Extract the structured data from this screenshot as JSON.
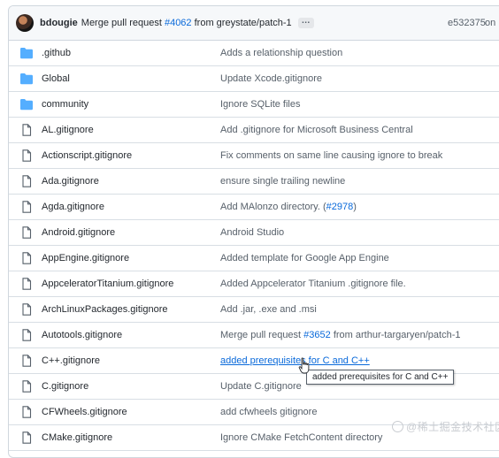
{
  "commit": {
    "author": "bdougie",
    "message_prefix": "Merge pull request",
    "pr_link": "#4062",
    "message_suffix": "from greystate/patch-1",
    "ellipsis": "…",
    "sha": "e532375",
    "on": "on"
  },
  "files": [
    {
      "type": "folder",
      "name": ".github",
      "message": "Adds a relationship question"
    },
    {
      "type": "folder",
      "name": "Global",
      "message": "Update Xcode.gitignore"
    },
    {
      "type": "folder",
      "name": "community",
      "message": "Ignore SQLite files"
    },
    {
      "type": "file",
      "name": "AL.gitignore",
      "message": "Add .gitignore for Microsoft Business Central"
    },
    {
      "type": "file",
      "name": "Actionscript.gitignore",
      "message": "Fix comments on same line causing ignore to break"
    },
    {
      "type": "file",
      "name": "Ada.gitignore",
      "message": "ensure single trailing newline"
    },
    {
      "type": "file",
      "name": "Agda.gitignore",
      "message": "Add MAlonzo directory. (",
      "link": "#2978",
      "after": ")"
    },
    {
      "type": "file",
      "name": "Android.gitignore",
      "message": "Android Studio"
    },
    {
      "type": "file",
      "name": "AppEngine.gitignore",
      "message": "Added template for Google App Engine"
    },
    {
      "type": "file",
      "name": "AppceleratorTitanium.gitignore",
      "message": "Added Appcelerator Titanium .gitignore file."
    },
    {
      "type": "file",
      "name": "ArchLinuxPackages.gitignore",
      "message": "Add .jar, .exe and .msi"
    },
    {
      "type": "file",
      "name": "Autotools.gitignore",
      "message": "Merge pull request ",
      "link": "#3652",
      "after": " from arthur-targaryen/patch-1"
    },
    {
      "type": "file",
      "name": "C++.gitignore",
      "message": "added prerequisites for C and C++",
      "hover": true
    },
    {
      "type": "file",
      "name": "C.gitignore",
      "message": "Update C.gitignore"
    },
    {
      "type": "file",
      "name": "CFWheels.gitignore",
      "message": "add cfwheels gitignore"
    },
    {
      "type": "file",
      "name": "CMake.gitignore",
      "message": "Ignore CMake FetchContent directory"
    }
  ],
  "tooltip": "added prerequisites for C and C++",
  "watermark": "@稀土掘金技术社区",
  "icons": {
    "folder": "folder-icon",
    "file": "file-icon",
    "cursor": "hand-pointer-icon"
  },
  "colors": {
    "folder": "#54aeff",
    "link": "#0969da",
    "muted": "#57606a",
    "header_bg": "#f6f8fa"
  }
}
